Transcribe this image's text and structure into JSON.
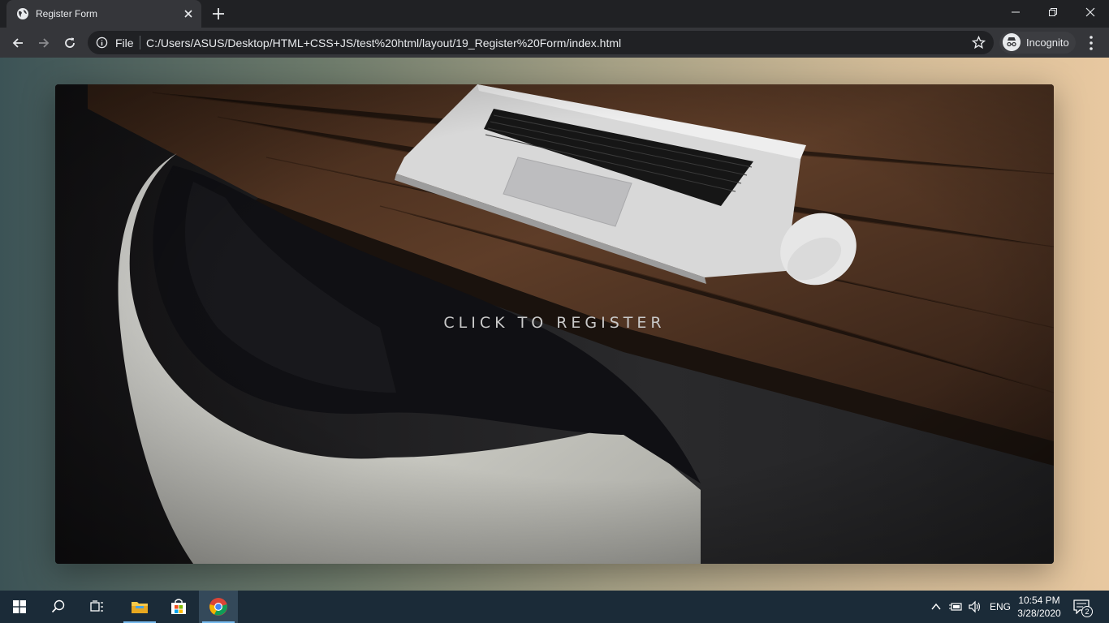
{
  "browser": {
    "tab_title": "Register Form",
    "omnibox_scheme": "File",
    "omnibox_url": "C:/Users/ASUS/Desktop/HTML+CSS+JS/test%20html/layout/19_Register%20Form/index.html",
    "profile_label": "Incognito"
  },
  "page": {
    "cta_text": "CLICK TO REGISTER"
  },
  "taskbar": {
    "language": "ENG",
    "time": "10:54 PM",
    "date": "3/28/2020",
    "notification_count": "2"
  },
  "colors": {
    "chrome_dark": "#202124",
    "chrome_toolbar": "#35363a",
    "taskbar": "#1b2b38",
    "taskbar_accent": "#76b9ed"
  }
}
